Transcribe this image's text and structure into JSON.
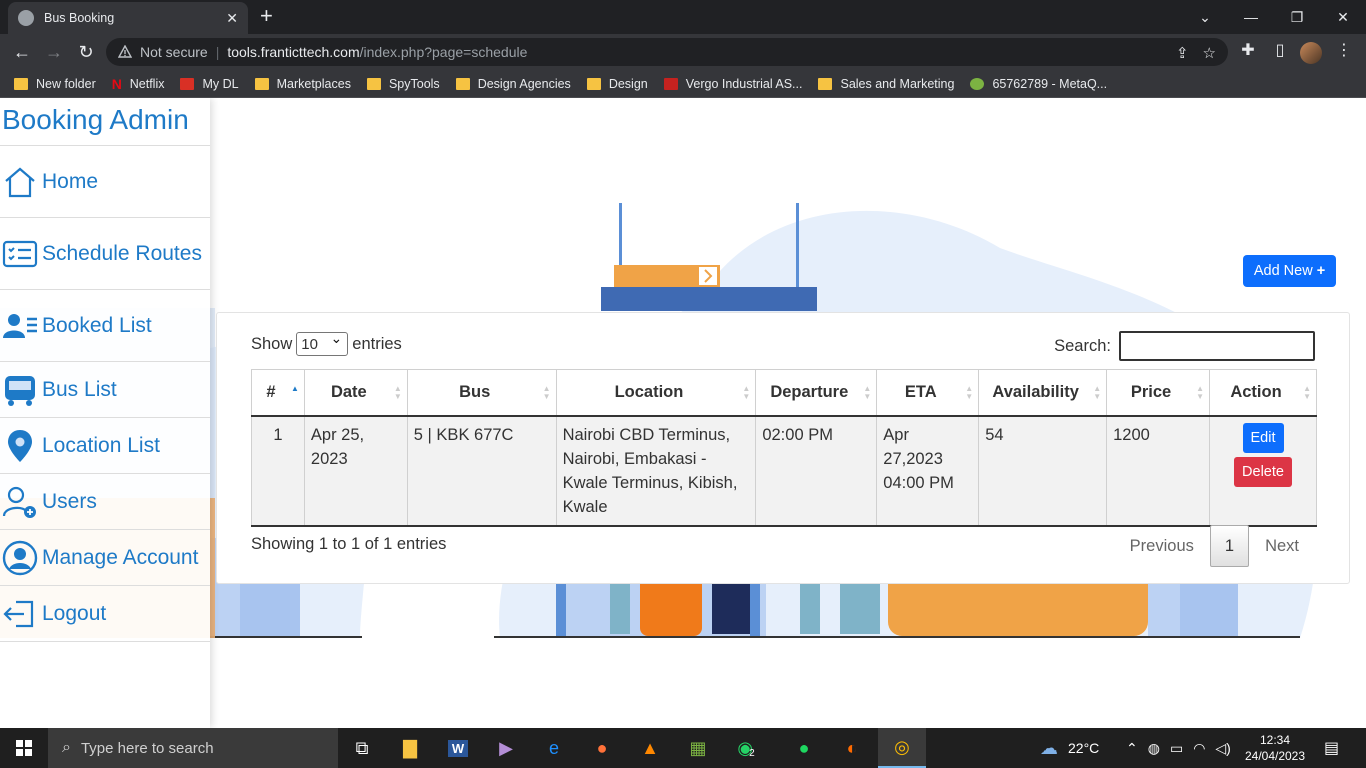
{
  "browser": {
    "tab_title": "Bus Booking",
    "new_tab": "+",
    "url_security": "Not secure",
    "url_host": "tools.franticttech.com",
    "url_path": "/index.php?page=schedule",
    "bookmarks": [
      {
        "label": "New folder",
        "icon": "folder-icon"
      },
      {
        "label": "Netflix",
        "icon": "netflix-icon"
      },
      {
        "label": "My DL",
        "icon": "mydl-icon"
      },
      {
        "label": "Marketplaces",
        "icon": "folder-icon"
      },
      {
        "label": "SpyTools",
        "icon": "folder-icon"
      },
      {
        "label": "Design Agencies",
        "icon": "folder-icon"
      },
      {
        "label": "Design",
        "icon": "folder-icon"
      },
      {
        "label": "Vergo Industrial AS...",
        "icon": "vergo-icon"
      },
      {
        "label": "Sales and Marketing",
        "icon": "folder-icon"
      },
      {
        "label": "65762789 - MetaQ...",
        "icon": "metaq-icon"
      }
    ]
  },
  "sidebar": {
    "brand": "Booking Admin",
    "items": [
      {
        "label": "Home",
        "icon": "home-icon"
      },
      {
        "label": "Schedule Routes",
        "icon": "checklist-icon"
      },
      {
        "label": "Booked List",
        "icon": "users-list-icon"
      },
      {
        "label": "Bus List",
        "icon": "bus-icon"
      },
      {
        "label": "Location List",
        "icon": "location-pin-icon"
      },
      {
        "label": "Users",
        "icon": "user-add-icon"
      },
      {
        "label": "Manage Account",
        "icon": "user-circle-icon"
      },
      {
        "label": "Logout",
        "icon": "logout-icon"
      }
    ]
  },
  "main": {
    "add_new_label": "Add New",
    "length": {
      "prefix": "Show",
      "value": "10",
      "suffix": "entries"
    },
    "search_label": "Search:",
    "search_value": "",
    "columns": [
      "#",
      "Date",
      "Bus",
      "Location",
      "Departure",
      "ETA",
      "Availability",
      "Price",
      "Action"
    ],
    "rows": [
      {
        "num": "1",
        "date": "Apr 25, 2023",
        "bus": "5 | KBK 677C",
        "location": "Nairobi CBD Terminus, Nairobi, Embakasi - Kwale Terminus, Kibish, Kwale",
        "departure": "02:00 PM",
        "eta": "Apr 27,2023 04:00 PM",
        "availability": "54",
        "price": "1200",
        "edit_label": "Edit",
        "delete_label": "Delete"
      }
    ],
    "info": "Showing 1 to 1 of 1 entries",
    "pager": {
      "previous": "Previous",
      "current": "1",
      "next": "Next"
    }
  },
  "taskbar": {
    "search_placeholder": "Type here to search",
    "weather": "22°C",
    "time": "12:34",
    "date": "24/04/2023",
    "whatsapp_badge": "2"
  },
  "colors": {
    "brand_blue": "#1e7ac7",
    "primary_button": "#0d6efd",
    "danger_button": "#dc3545",
    "chrome_dark": "#202124"
  }
}
